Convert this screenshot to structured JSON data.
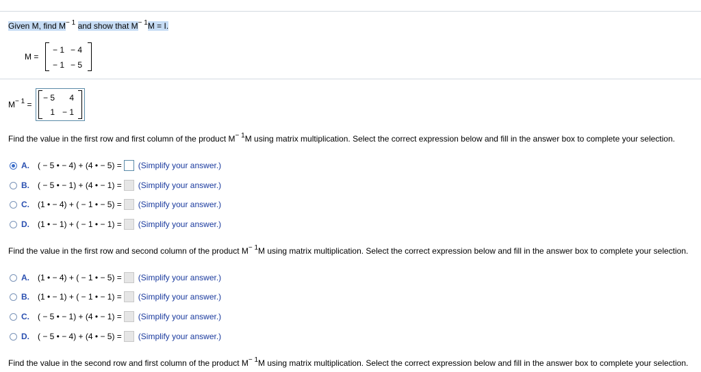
{
  "header": {
    "part1": "Given M, find M",
    "sup": "− 1",
    "part2": "and show that M",
    "part3": "M = I."
  },
  "matrix_m": {
    "label": "M =",
    "rows": [
      [
        "− 1",
        "− 4"
      ],
      [
        "− 1",
        "− 5"
      ]
    ]
  },
  "matrix_inv": {
    "label": "M",
    "sup": "− 1",
    "eq": "=",
    "rows": [
      [
        "− 5",
        "4"
      ],
      [
        "1",
        "− 1"
      ]
    ]
  },
  "questions": [
    {
      "text_before": "Find the value in the first row and first column of the product M",
      "sup": "− 1",
      "text_after": "M using matrix multiplication. Select the correct expression below and fill in the answer box to complete your selection.",
      "options": [
        {
          "letter": "A.",
          "expr": "( − 5 •  − 4) + (4 •  − 5) =",
          "hint": "(Simplify your answer.)",
          "selected": true,
          "answer": ""
        },
        {
          "letter": "B.",
          "expr": "( − 5 •  − 1) + (4 •  − 1) =",
          "hint": "(Simplify your answer.)",
          "selected": false,
          "answer": ""
        },
        {
          "letter": "C.",
          "expr": "(1 •  − 4) + ( − 1 •  − 5) =",
          "hint": "(Simplify your answer.)",
          "selected": false,
          "answer": ""
        },
        {
          "letter": "D.",
          "expr": "(1 •  − 1) + ( − 1 •  − 1) =",
          "hint": "(Simplify your answer.)",
          "selected": false,
          "answer": ""
        }
      ]
    },
    {
      "text_before": "Find the value in the first row and second column of the product M",
      "sup": "− 1",
      "text_after": "M using matrix multiplication. Select the correct expression below and fill in the answer box to complete your selection.",
      "options": [
        {
          "letter": "A.",
          "expr": "(1 •  − 4) + ( − 1 •  − 5) =",
          "hint": "(Simplify your answer.)",
          "selected": false,
          "answer": ""
        },
        {
          "letter": "B.",
          "expr": "(1 •  − 1) + ( − 1 •  − 1) =",
          "hint": "(Simplify your answer.)",
          "selected": false,
          "answer": ""
        },
        {
          "letter": "C.",
          "expr": "( − 5 •  − 1) + (4 •  − 1) =",
          "hint": "(Simplify your answer.)",
          "selected": false,
          "answer": ""
        },
        {
          "letter": "D.",
          "expr": "( − 5 •  − 4) + (4 •  − 5) =",
          "hint": "(Simplify your answer.)",
          "selected": false,
          "answer": ""
        }
      ]
    },
    {
      "text_before": "Find the value in the second row and first column of the product M",
      "sup": "− 1",
      "text_after": "M using matrix multiplication. Select the correct expression below and fill in the answer box to complete your selection."
    }
  ]
}
